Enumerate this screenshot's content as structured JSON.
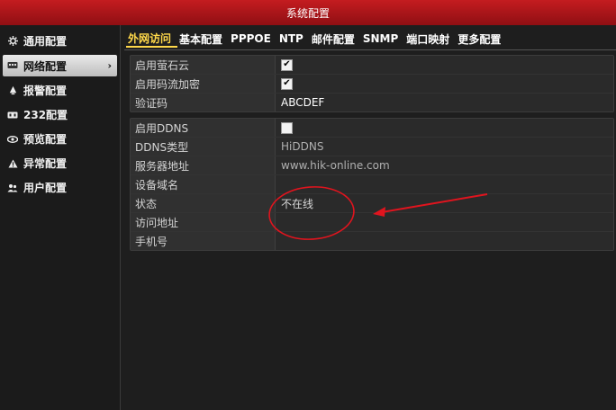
{
  "window": {
    "title": "系统配置"
  },
  "sidebar": {
    "items": [
      {
        "label": "通用配置",
        "icon": "gear-icon"
      },
      {
        "label": "网络配置",
        "icon": "network-icon",
        "active": true
      },
      {
        "label": "报警配置",
        "icon": "alarm-icon"
      },
      {
        "label": "232配置",
        "icon": "serial-icon"
      },
      {
        "label": "预览配置",
        "icon": "eye-icon"
      },
      {
        "label": "异常配置",
        "icon": "warning-icon"
      },
      {
        "label": "用户配置",
        "icon": "users-icon"
      }
    ]
  },
  "tabs": [
    {
      "label": "外网访问",
      "active": true
    },
    {
      "label": "基本配置"
    },
    {
      "label": "PPPOE"
    },
    {
      "label": "NTP"
    },
    {
      "label": "邮件配置"
    },
    {
      "label": "SNMP"
    },
    {
      "label": "端口映射"
    },
    {
      "label": "更多配置"
    }
  ],
  "ezviz_panel": {
    "enable_ezviz": {
      "label": "启用萤石云",
      "checked": true
    },
    "enable_stream_encrypt": {
      "label": "启用码流加密",
      "checked": true
    },
    "verify_code": {
      "label": "验证码",
      "value": "ABCDEF"
    }
  },
  "ddns_panel": {
    "enable_ddns": {
      "label": "启用DDNS",
      "checked": false
    },
    "ddns_type": {
      "label": "DDNS类型",
      "value": "HiDDNS"
    },
    "server_address": {
      "label": "服务器地址",
      "value": "www.hik-online.com"
    },
    "device_domain": {
      "label": "设备域名",
      "value": ""
    },
    "status": {
      "label": "状态",
      "value": "不在线"
    },
    "access_address": {
      "label": "访问地址",
      "value": ""
    },
    "phone": {
      "label": "手机号",
      "value": ""
    }
  },
  "colors": {
    "title_bar": "#b3161a",
    "active_tab": "#ffd84a",
    "annotation": "#e0141e"
  }
}
